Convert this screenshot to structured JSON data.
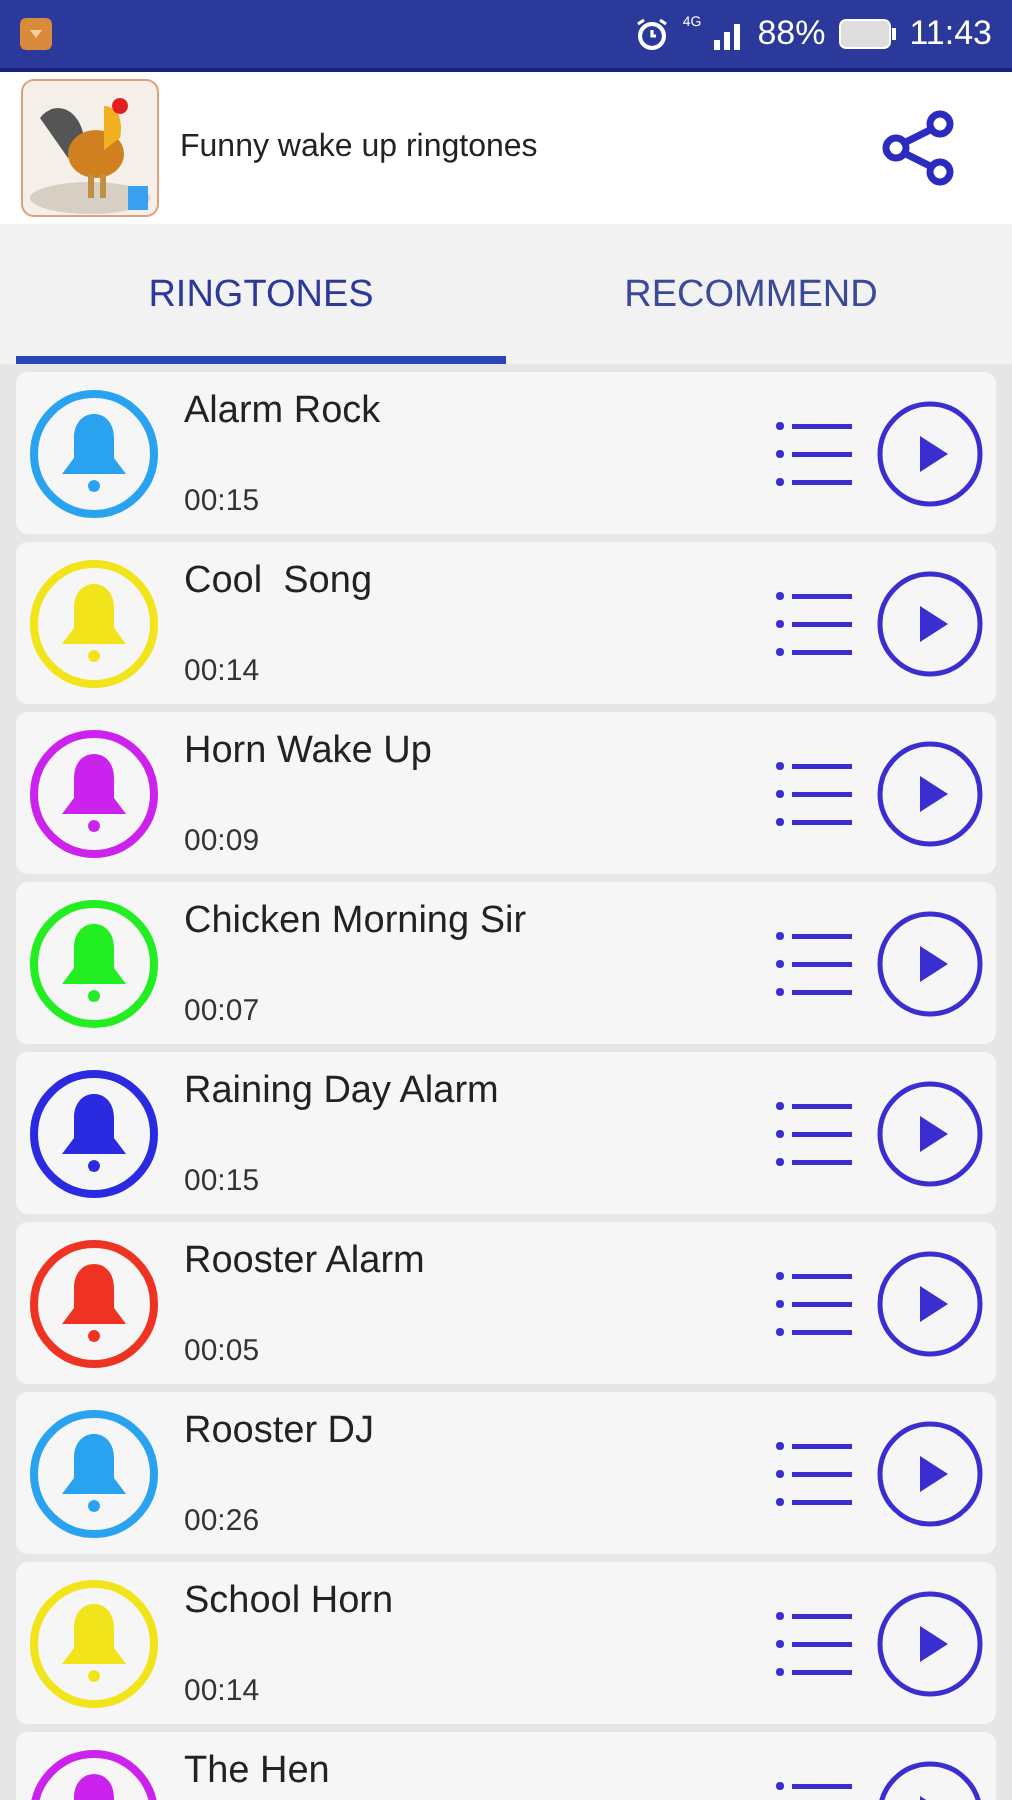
{
  "status_bar": {
    "network": "4G",
    "battery": "88%",
    "time": "11:43"
  },
  "header": {
    "title": "Funny wake up ringtones"
  },
  "tabs": [
    {
      "label": "RINGTONES",
      "selected": true
    },
    {
      "label": "RECOMMEND",
      "selected": false
    }
  ],
  "ringtones": [
    {
      "name": "Alarm Rock",
      "duration": "00:15",
      "color": "#29a3f0"
    },
    {
      "name": "Cool  Song",
      "duration": "00:14",
      "color": "#f2e41a"
    },
    {
      "name": "Horn Wake Up",
      "duration": "00:09",
      "color": "#cc22ee"
    },
    {
      "name": "Chicken Morning Sir",
      "duration": "00:07",
      "color": "#22ee22"
    },
    {
      "name": "Raining Day Alarm",
      "duration": "00:15",
      "color": "#2a2ae0"
    },
    {
      "name": "Rooster Alarm",
      "duration": "00:05",
      "color": "#ee3322"
    },
    {
      "name": "Rooster DJ",
      "duration": "00:26",
      "color": "#29a3f0"
    },
    {
      "name": "School Horn",
      "duration": "00:14",
      "color": "#f2e41a"
    },
    {
      "name": "The Hen",
      "color": "#cc22ee"
    }
  ]
}
